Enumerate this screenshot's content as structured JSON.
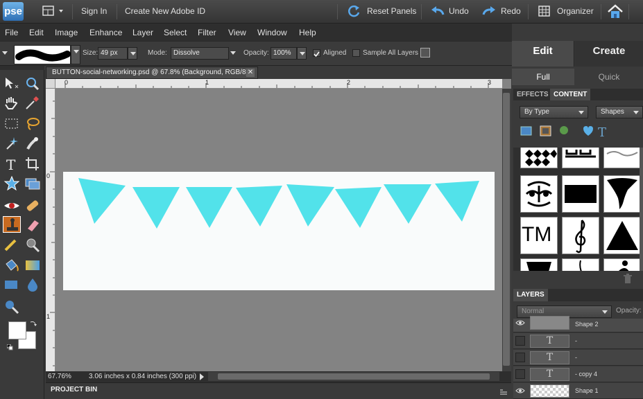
{
  "app": {
    "logo": "pse",
    "sign_in": "Sign In",
    "create_id": "Create New Adobe ID",
    "reset_panels": "Reset Panels",
    "undo": "Undo",
    "redo": "Redo",
    "organizer": "Organizer"
  },
  "menu": [
    "File",
    "Edit",
    "Image",
    "Enhance",
    "Layer",
    "Select",
    "Filter",
    "View",
    "Window",
    "Help"
  ],
  "mode_tabs": {
    "edit": "Edit",
    "create": "Create",
    "full": "Full",
    "quick": "Quick"
  },
  "options": {
    "size_label": "Size:",
    "size_value": "49 px",
    "mode_label": "Mode:",
    "mode_value": "Dissolve",
    "opacity_label": "Opacity:",
    "opacity_value": "100%",
    "aligned_label": "Aligned",
    "aligned_checked": true,
    "sample_all_label": "Sample All Layers",
    "sample_all_checked": false
  },
  "document": {
    "tab_title": "BUTTON-social-networking.psd @ 67.8% (Background, RGB/8) *",
    "close": "✕",
    "zoom": "67.76%",
    "doc_size": "3.06 inches x 0.84 inches (300 ppi)",
    "ruler_top": [
      "0",
      "1",
      "2",
      "3"
    ],
    "ruler_left": [
      "0",
      "1"
    ],
    "pennant_color": "#52e2ea",
    "canvas_color": "#f9fbfb"
  },
  "project_bin": "PROJECT BIN",
  "panel": {
    "effects_tab": "EFFECTS",
    "content_tab": "CONTENT",
    "filter_by": "By Type",
    "category": "Shapes",
    "tm_label": "TM"
  },
  "layers": {
    "title": "LAYERS",
    "blend_mode": "Normal",
    "opacity_label": "Opacity:",
    "rows": [
      {
        "name": "Shape 2",
        "thumb": "",
        "visible": true
      },
      {
        "name": "-",
        "thumb": "T",
        "visible": false
      },
      {
        "name": "-",
        "thumb": "T",
        "visible": false
      },
      {
        "name": "- copy 4",
        "thumb": "T",
        "visible": false
      },
      {
        "name": "Shape 1",
        "thumb": "",
        "visible": true
      }
    ]
  }
}
